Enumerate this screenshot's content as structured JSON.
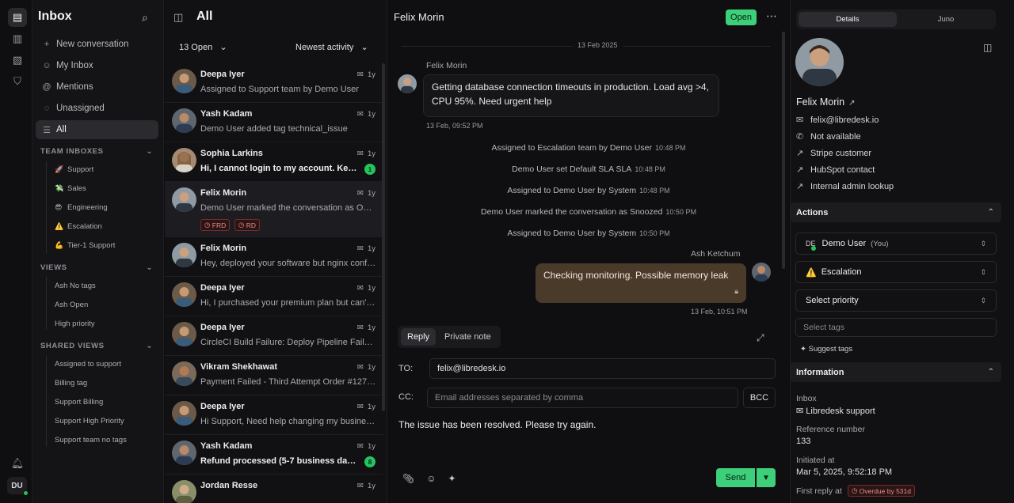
{
  "rail": {
    "user_initials": "DU"
  },
  "sidebar": {
    "title": "Inbox",
    "nav": [
      {
        "label": "New conversation",
        "icon": "plus-icon"
      },
      {
        "label": "My Inbox",
        "icon": "user-icon"
      },
      {
        "label": "Mentions",
        "icon": "at-icon"
      },
      {
        "label": "Unassigned",
        "icon": "dashed-circle-icon"
      },
      {
        "label": "All",
        "icon": "list-icon"
      }
    ],
    "team_inboxes_label": "TEAM INBOXES",
    "team_inboxes": [
      {
        "emoji": "🚀",
        "label": "Support"
      },
      {
        "emoji": "💸",
        "label": "Sales"
      },
      {
        "emoji": "😎",
        "label": "Engineering"
      },
      {
        "emoji": "⚠️",
        "label": "Escalation"
      },
      {
        "emoji": "💪",
        "label": "Tier-1 Support"
      }
    ],
    "views_label": "VIEWS",
    "views": [
      "Ash No tags",
      "Ash Open",
      "High priority"
    ],
    "shared_views_label": "SHARED VIEWS",
    "shared_views": [
      "Assigned to support",
      "Billing tag",
      "Support Billing",
      "Support High Priority",
      "Support team no tags"
    ]
  },
  "list": {
    "title": "All",
    "status_filter": "13 Open",
    "sort_filter": "Newest activity",
    "conversations": [
      {
        "name": "Deepa Iyer",
        "time": "1y",
        "preview": "Assigned to Support team by Demo User",
        "unread": false,
        "badge": ""
      },
      {
        "name": "Yash Kadam",
        "time": "1y",
        "preview": "Demo User added tag technical_issue",
        "unread": false,
        "badge": ""
      },
      {
        "name": "Sophia Larkins",
        "time": "1y",
        "preview": "Hi, I cannot login to my account. Keep getting errors",
        "unread": true,
        "badge": "1"
      },
      {
        "name": "Felix Morin",
        "time": "1y",
        "preview": "Demo User marked the conversation as Open",
        "unread": false,
        "badge": "",
        "tags": [
          "FRD",
          "RD"
        ]
      },
      {
        "name": "Felix Morin",
        "time": "1y",
        "preview": "Hey, deployed your software but nginx config fails",
        "unread": false,
        "badge": ""
      },
      {
        "name": "Deepa Iyer",
        "time": "1y",
        "preview": "Hi, I purchased your premium plan but can't access",
        "unread": false,
        "badge": ""
      },
      {
        "name": "Deepa Iyer",
        "time": "1y",
        "preview": "CircleCI Build Failure: Deploy Pipeline Failed on main",
        "unread": false,
        "badge": ""
      },
      {
        "name": "Vikram Shekhawat",
        "time": "1y",
        "preview": "Payment Failed - Third Attempt Order #1276543",
        "unread": false,
        "badge": ""
      },
      {
        "name": "Deepa Iyer",
        "time": "1y",
        "preview": "Hi Support, Need help changing my business address",
        "unread": false,
        "badge": ""
      },
      {
        "name": "Yash Kadam",
        "time": "1y",
        "preview": "Refund processed (5-7 business days). Thanks",
        "unread": true,
        "badge": "8"
      },
      {
        "name": "Jordan Resse",
        "time": "1y",
        "preview": "",
        "unread": false,
        "badge": ""
      }
    ]
  },
  "chat": {
    "contact": "Felix Morin",
    "status": "Open",
    "date": "13 Feb 2025",
    "incoming": {
      "sender": "Felix Morin",
      "text": "Getting database connection timeouts in production. Load avg >4, CPU 95%. Need urgent help",
      "time": "13 Feb, 09:52 PM"
    },
    "activities": [
      {
        "text": "Assigned to Escalation team by Demo User",
        "time": "10:48 PM"
      },
      {
        "text": "Demo User set Default SLA SLA",
        "time": "10:48 PM"
      },
      {
        "text": "Assigned to Demo User by System",
        "time": "10:48 PM"
      },
      {
        "text": "Demo User marked the conversation as Snoozed",
        "time": "10:50 PM"
      },
      {
        "text": "Assigned to Demo User by System",
        "time": "10:50 PM"
      }
    ],
    "outgoing": {
      "sender": "Ash Ketchum",
      "text": "Checking monitoring. Possible memory leak",
      "time": "13 Feb, 10:51 PM"
    }
  },
  "composer": {
    "tab_reply": "Reply",
    "tab_note": "Private note",
    "to_label": "TO:",
    "to_value": "felix@libredesk.io",
    "cc_label": "CC:",
    "cc_placeholder": "Email addresses separated by comma",
    "bcc_label": "BCC",
    "body": "The issue has been resolved. Please try again.",
    "send_label": "Send"
  },
  "details": {
    "tab_details": "Details",
    "tab_juno": "Juno",
    "name": "Felix Morin",
    "email": "felix@libredesk.io",
    "phone": "Not available",
    "links": [
      "Stripe customer",
      "HubSpot contact",
      "Internal admin lookup"
    ],
    "actions_label": "Actions",
    "assignee_initials": "DE",
    "assignee": "Demo User",
    "assignee_you": "(You)",
    "team": "Escalation",
    "priority_placeholder": "Select priority",
    "tags_placeholder": "Select tags",
    "suggest_tags": "Suggest tags",
    "information_label": "Information",
    "inbox_label": "Inbox",
    "inbox_value": "Libredesk support",
    "ref_label": "Reference number",
    "ref_value": "133",
    "initiated_label": "Initiated at",
    "initiated_value": "Mar 5, 2025, 9:52:18 PM",
    "first_reply_label": "First reply at",
    "overdue": "Overdue by 531d"
  }
}
